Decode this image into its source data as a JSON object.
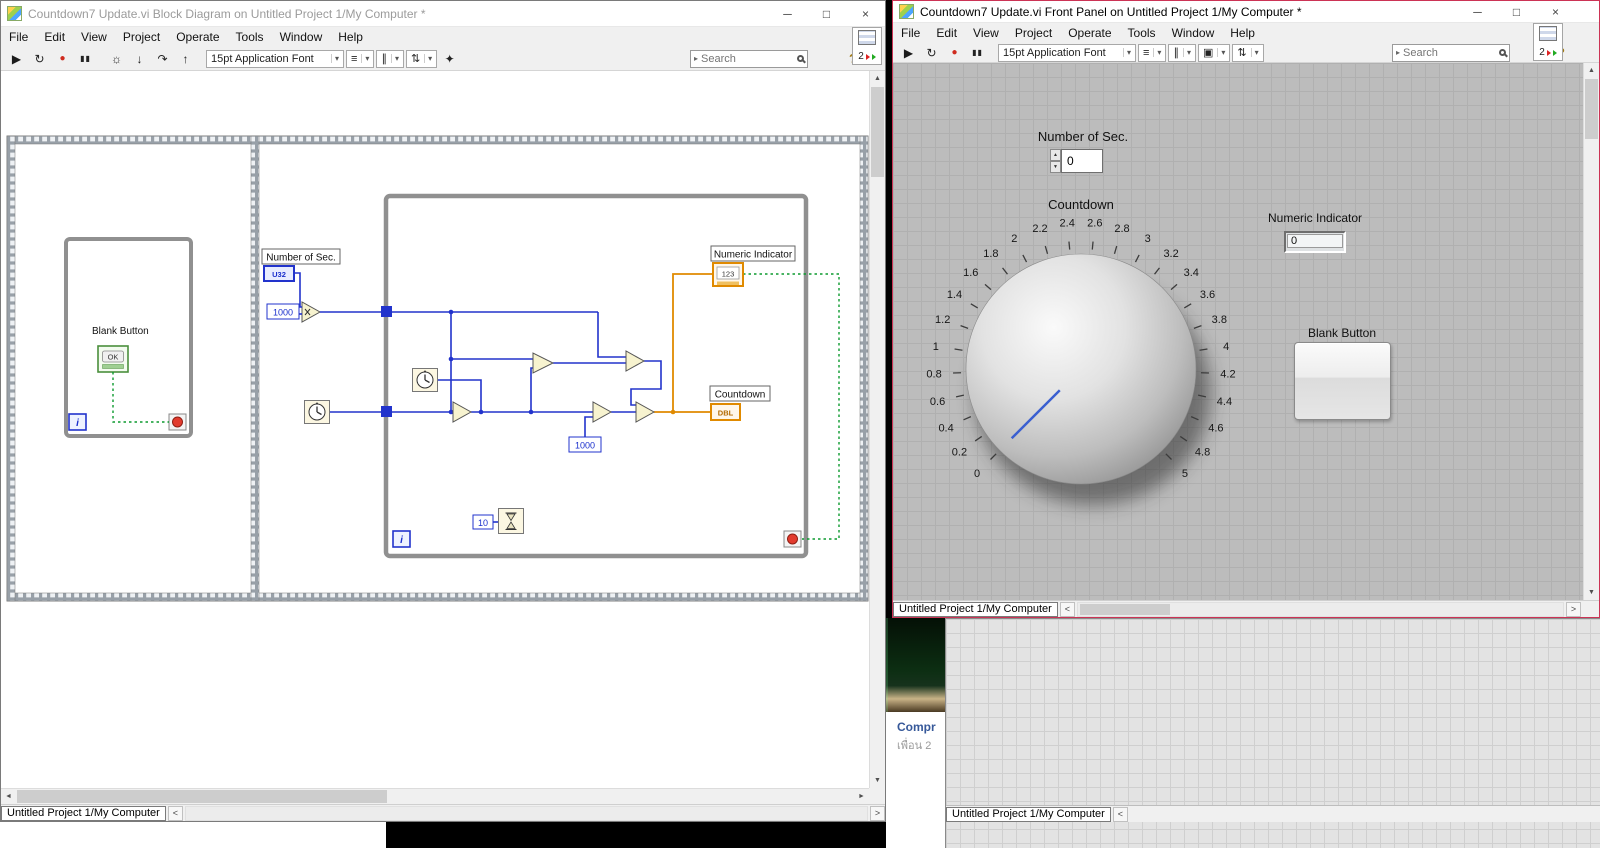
{
  "menus": [
    "File",
    "Edit",
    "View",
    "Project",
    "Operate",
    "Tools",
    "Window",
    "Help"
  ],
  "icons": {
    "run": "▶",
    "run_continuous": "↻",
    "abort": "●",
    "pause": "▮▮",
    "highlight_execution": "☼",
    "step_into": "↓",
    "step_over": "↷",
    "step_out": "↑",
    "align": "≡",
    "distribute": "∥",
    "resize": "▣",
    "reorder": "⇅",
    "clean_up": "✦",
    "dropdown_arrow": "▾",
    "caret_right": "▸",
    "help": "?",
    "minimize": "─",
    "maximize": "□",
    "close": "×",
    "scroll_up": "▲",
    "scroll_down": "▼",
    "scroll_left": "◄",
    "scroll_right": "►",
    "nav_left": "<",
    "nav_right": ">"
  },
  "block_diagram_window": {
    "title": "Countdown7 Update.vi Block Diagram on Untitled Project 1/My Computer *",
    "toolbar": {
      "font": "15pt Application Font",
      "search_placeholder": "Search"
    },
    "vi_icon_badge": "2",
    "status_tab": "Untitled Project 1/My Computer",
    "diagram": {
      "number_of_sec_label": "Number of Sec.",
      "numeric_indicator_label": "Numeric Indicator",
      "countdown_label": "Countdown",
      "blank_button_label": "Blank Button",
      "u32_terminal": "U32",
      "numeric_terminal": "123",
      "dbl_terminal": "DBL",
      "ok_terminal": "OK",
      "iteration_terminal": "i",
      "const_1000_a": "1000",
      "const_1000_b": "1000",
      "const_10": "10"
    }
  },
  "front_panel_window": {
    "title": "Countdown7 Update.vi Front Panel on Untitled Project 1/My Computer *",
    "toolbar": {
      "font": "15pt Application Font",
      "search_placeholder": "Search"
    },
    "vi_icon_badge": "2",
    "status_tab": "Untitled Project 1/My Computer",
    "controls": {
      "number_of_sec": {
        "label": "Number of Sec.",
        "value": "0"
      },
      "countdown_knob": {
        "label": "Countdown",
        "min": 0,
        "max": 5,
        "value": 0,
        "needle_color": "#3a5fd0",
        "scale_labels": [
          "0",
          "0.2",
          "0.4",
          "0.6",
          "0.8",
          "1",
          "1.2",
          "1.4",
          "1.6",
          "1.8",
          "2",
          "2.2",
          "2.4",
          "2.6",
          "2.8",
          "3",
          "3.2",
          "3.4",
          "3.6",
          "3.8",
          "4",
          "4.2",
          "4.4",
          "4.6",
          "4.8",
          "5"
        ]
      },
      "numeric_indicator": {
        "label": "Numeric Indicator",
        "value": "0"
      },
      "blank_button": {
        "label": "Blank Button"
      }
    }
  },
  "background_window": {
    "status_tab": "Untitled Project 1/My Computer"
  },
  "browser_card": {
    "title": "Compr",
    "subtitle": "เพื่อน 2"
  }
}
